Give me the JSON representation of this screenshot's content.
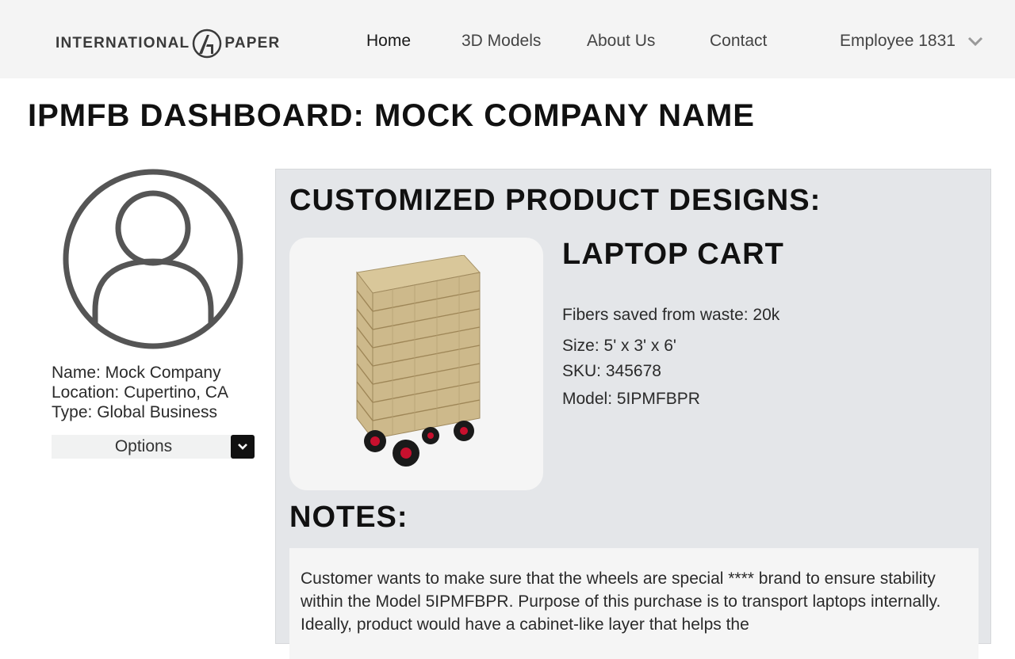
{
  "header": {
    "logo_left": "INTERNATIONAL",
    "logo_right": "PAPER",
    "nav": {
      "home": "Home",
      "models": "3D Models",
      "about": "About Us",
      "contact": "Contact"
    },
    "user": "Employee 1831"
  },
  "page_title": "IPMFB DASHBOARD: MOCK COMPANY NAME",
  "profile": {
    "name": "Name: Mock Company",
    "location": "Location: Cupertino, CA",
    "type": "Type: Global Business",
    "options_label": "Options"
  },
  "designs": {
    "title": "CUSTOMIZED PRODUCT DESIGNS:",
    "product": {
      "name": "LAPTOP CART",
      "fibers": "Fibers saved from waste: 20k",
      "size": "Size: 5' x 3' x 6'",
      "sku": "SKU: 345678",
      "model": "Model: 5IPMFBPR"
    }
  },
  "notes": {
    "title": "NOTES:",
    "text": "Customer wants to make sure that the wheels are special **** brand to ensure stability within the Model 5IPMFBPR. Purpose of this purchase is to transport laptops internally. Ideally, product would have a cabinet-like layer that helps the"
  },
  "colors": {
    "topbar_bg": "#f4f4f4",
    "panel_bg": "#e4e6e9",
    "avatar_stroke": "#555555",
    "wheel_accent": "#c8102e"
  }
}
